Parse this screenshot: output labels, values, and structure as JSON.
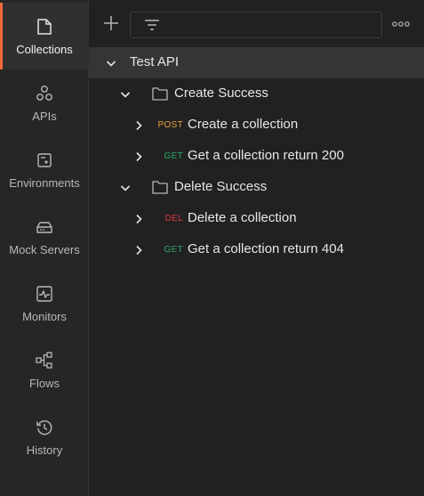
{
  "sidebar": {
    "items": [
      {
        "label": "Collections",
        "icon": "collections-icon",
        "active": true
      },
      {
        "label": "APIs",
        "icon": "apis-icon"
      },
      {
        "label": "Environments",
        "icon": "environments-icon"
      },
      {
        "label": "Mock Servers",
        "icon": "mock-servers-icon"
      },
      {
        "label": "Monitors",
        "icon": "monitors-icon"
      },
      {
        "label": "Flows",
        "icon": "flows-icon"
      },
      {
        "label": "History",
        "icon": "history-icon"
      }
    ]
  },
  "toolbar": {
    "add_icon": "plus-icon",
    "filter_icon": "filter-icon",
    "more_icon": "more-horizontal-icon"
  },
  "tree": {
    "collection": {
      "name": "Test API",
      "expanded": true
    },
    "folders": [
      {
        "name": "Create Success",
        "requests": [
          {
            "method": "POST",
            "name": "Create a collection"
          },
          {
            "method": "GET",
            "name": "Get a collection return 200"
          }
        ]
      },
      {
        "name": "Delete Success",
        "requests": [
          {
            "method": "DEL",
            "name": "Delete a collection"
          },
          {
            "method": "GET",
            "name": "Get a collection return 404"
          }
        ]
      }
    ]
  },
  "colors": {
    "accent": "#f26b3a",
    "post": "#e8a33d",
    "get": "#2ea866",
    "del": "#e0393e"
  }
}
